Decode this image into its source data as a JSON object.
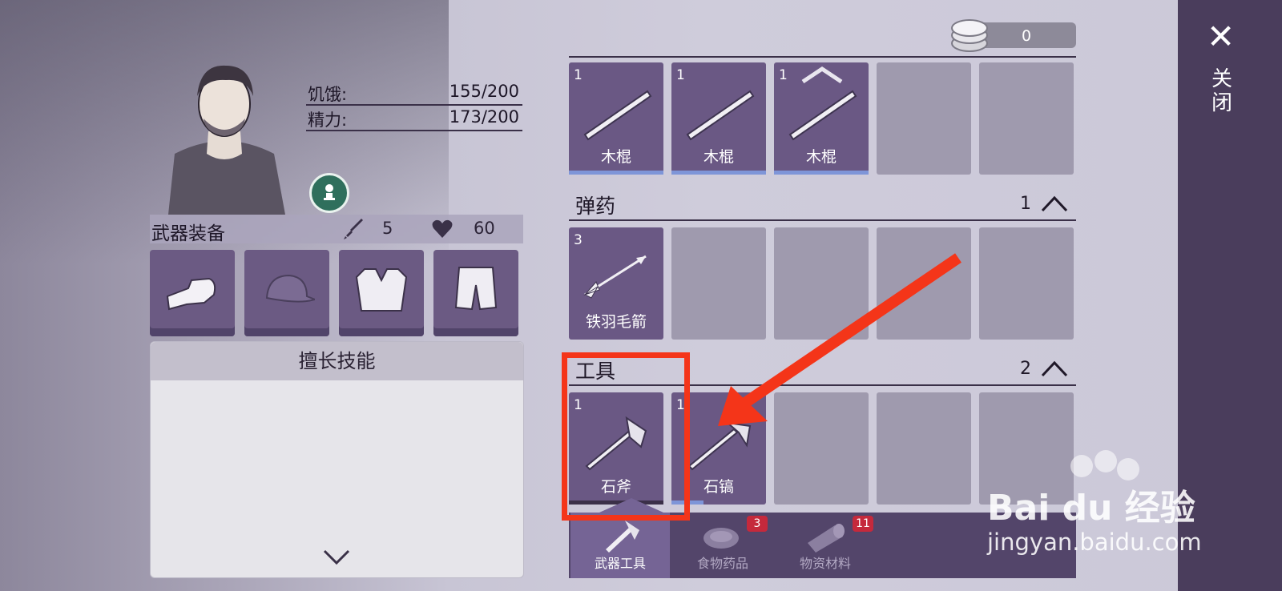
{
  "close": {
    "label": "关闭"
  },
  "currency": {
    "value": "0"
  },
  "character": {
    "stats": [
      {
        "label": "饥饿:",
        "value": "155/200"
      },
      {
        "label": "精力:",
        "value": "173/200"
      }
    ]
  },
  "equip": {
    "title": "武器装备",
    "attack": "5",
    "health": "60",
    "slots": [
      "fist-icon",
      "cap-icon",
      "vest-icon",
      "shorts-icon"
    ]
  },
  "skills": {
    "title": "擅长技能"
  },
  "inventory": {
    "weapons": {
      "items": [
        {
          "count": "1",
          "name": "木棍"
        },
        {
          "count": "1",
          "name": "木棍"
        },
        {
          "count": "1",
          "name": "木棍"
        }
      ]
    },
    "ammo": {
      "title": "弹药",
      "count": "1",
      "items": [
        {
          "count": "3",
          "name": "铁羽毛箭"
        }
      ]
    },
    "tools": {
      "title": "工具",
      "count": "2",
      "items": [
        {
          "count": "1",
          "name": "石斧"
        },
        {
          "count": "1",
          "name": "石镐"
        }
      ]
    }
  },
  "tabs": [
    {
      "label": "武器工具",
      "active": true
    },
    {
      "label": "食物药品",
      "badge": "3"
    },
    {
      "label": "物资材料",
      "badge": "11"
    }
  ],
  "watermark": {
    "brand": "Bai du 经验",
    "url": "jingyan.baidu.com"
  },
  "colors": {
    "accent": "#6a5884",
    "annotation": "#f43519",
    "sidebar": "#4a3d5c"
  }
}
